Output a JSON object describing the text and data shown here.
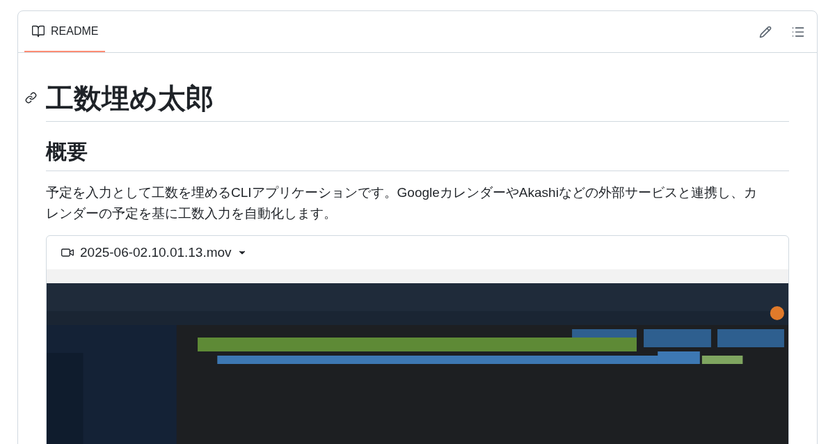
{
  "readme_tab": {
    "label": "README",
    "selected": true
  },
  "heading": "工数埋め太郎",
  "section_heading": "概要",
  "description": "予定を入力として工数を埋めるCLIアプリケーションです。GoogleカレンダーやAkashiなどの外部サービスと連携し、カレンダーの予定を基に工数入力を自動化します。",
  "video": {
    "filename": "2025-06-02.10.01.13.mov",
    "kind": "picture"
  }
}
